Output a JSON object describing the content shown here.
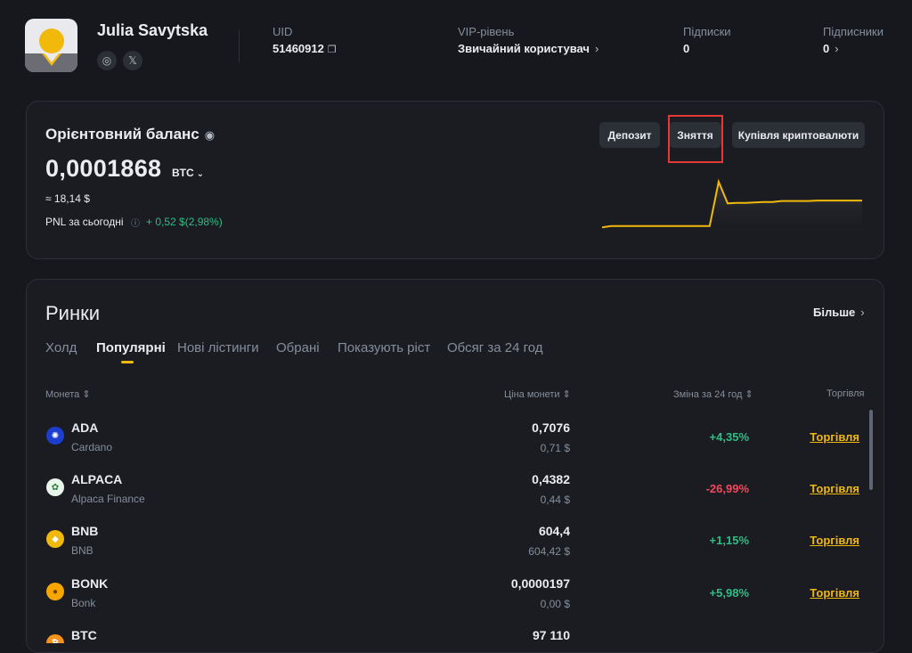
{
  "profile": {
    "name": "Julia Savytska",
    "uid_label": "UID",
    "uid_value": "51460912",
    "vip_label": "VIP-рівень",
    "vip_value": "Звичайний користувач",
    "subs_label": "Підписки",
    "subs_value": "0",
    "followers_label": "Підписники",
    "followers_value": "0"
  },
  "balance": {
    "title": "Орієнтовний баланс",
    "amount": "0,0001868",
    "unit": "BTC",
    "approx": "≈ 18,14 $",
    "pnl_label": "PNL за сьогодні",
    "pnl_value": "+ 0,52 $(2,98%)",
    "buttons": {
      "deposit": "Депозит",
      "withdraw": "Зняття",
      "buy": "Купівля криптовалюти"
    },
    "sparkline": [
      0.05,
      0.08,
      0.08,
      0.08,
      0.08,
      0.08,
      0.08,
      0.08,
      0.08,
      0.08,
      0.08,
      0.08,
      0.08,
      1.0,
      0.55,
      0.56,
      0.56,
      0.57,
      0.58,
      0.58,
      0.6,
      0.6,
      0.6,
      0.6,
      0.61,
      0.61,
      0.61,
      0.61,
      0.61,
      0.61
    ]
  },
  "markets": {
    "title": "Ринки",
    "more": "Більше",
    "tabs": [
      "Холд",
      "Популярні",
      "Нові лістинги",
      "Обрані",
      "Показують ріст",
      "Обсяг за 24 год"
    ],
    "columns": {
      "coin": "Монета",
      "price": "Ціна монети",
      "change": "Зміна за 24 год",
      "trade": "Торгівля"
    },
    "rows": [
      {
        "symbol": "ADA",
        "name": "Cardano",
        "price": "0,7076",
        "price_usd": "0,71 $",
        "change": "+4,35%",
        "trade": "Торгівля"
      },
      {
        "symbol": "ALPACA",
        "name": "Alpaca Finance",
        "price": "0,4382",
        "price_usd": "0,44 $",
        "change": "-26,99%",
        "trade": "Торгівля"
      },
      {
        "symbol": "BNB",
        "name": "BNB",
        "price": "604,4",
        "price_usd": "604,42 $",
        "change": "+1,15%",
        "trade": "Торгівля"
      },
      {
        "symbol": "BONK",
        "name": "Bonk",
        "price": "0,0000197",
        "price_usd": "0,00 $",
        "change": "+5,98%",
        "trade": "Торгівля"
      },
      {
        "symbol": "BTC",
        "name": "",
        "price": "97 110",
        "price_usd": "",
        "change": "",
        "trade": ""
      }
    ]
  },
  "colors": {
    "accent": "#f0b90b",
    "up": "#2ebd85",
    "down": "#f6465d",
    "highlight": "#e53935"
  }
}
